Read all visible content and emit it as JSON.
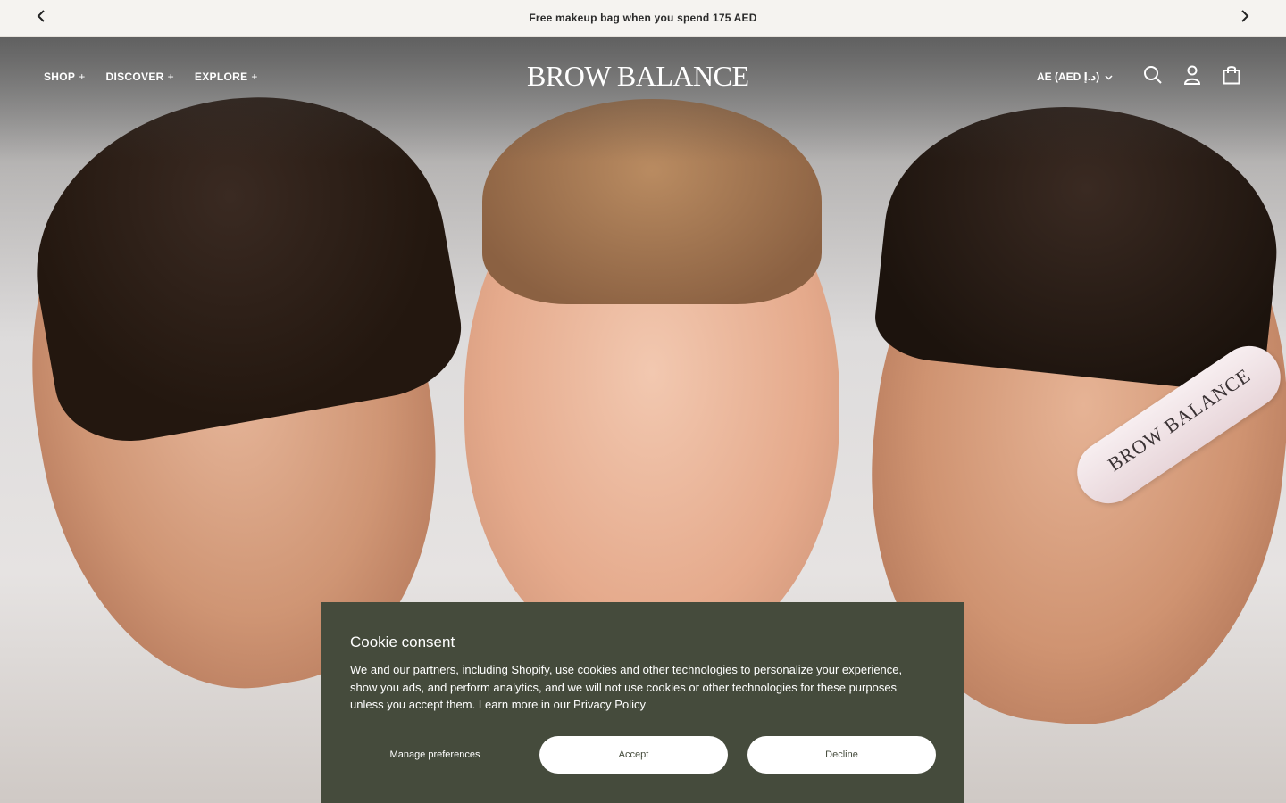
{
  "announcement": {
    "text": "Free makeup bag when you spend 175 AED"
  },
  "header": {
    "logo": "BROW BALANCE",
    "nav": [
      {
        "label": "SHOP",
        "suffix": "+"
      },
      {
        "label": "DISCOVER",
        "suffix": "+"
      },
      {
        "label": "EXPLORE",
        "suffix": "+"
      }
    ],
    "currency": "AE (AED د.إ)"
  },
  "hero": {
    "product_label": "BROW BALANCE"
  },
  "cookie": {
    "title": "Cookie consent",
    "body": "We and our partners, including Shopify, use cookies and other technologies to personalize your experience, show you ads, and perform analytics, and we will not use cookies or other technologies for these purposes unless you accept them.",
    "link_text": "Learn more in our Privacy Policy",
    "manage": "Manage preferences",
    "accept": "Accept",
    "decline": "Decline"
  },
  "colors": {
    "cookie_bg": "#454b3c",
    "announce_bg": "#f5f3f0"
  },
  "icons": {
    "prev": "chevron-left-icon",
    "next": "chevron-right-icon",
    "search": "search-icon",
    "account": "user-icon",
    "cart": "bag-icon",
    "dropdown": "chevron-down-icon"
  }
}
